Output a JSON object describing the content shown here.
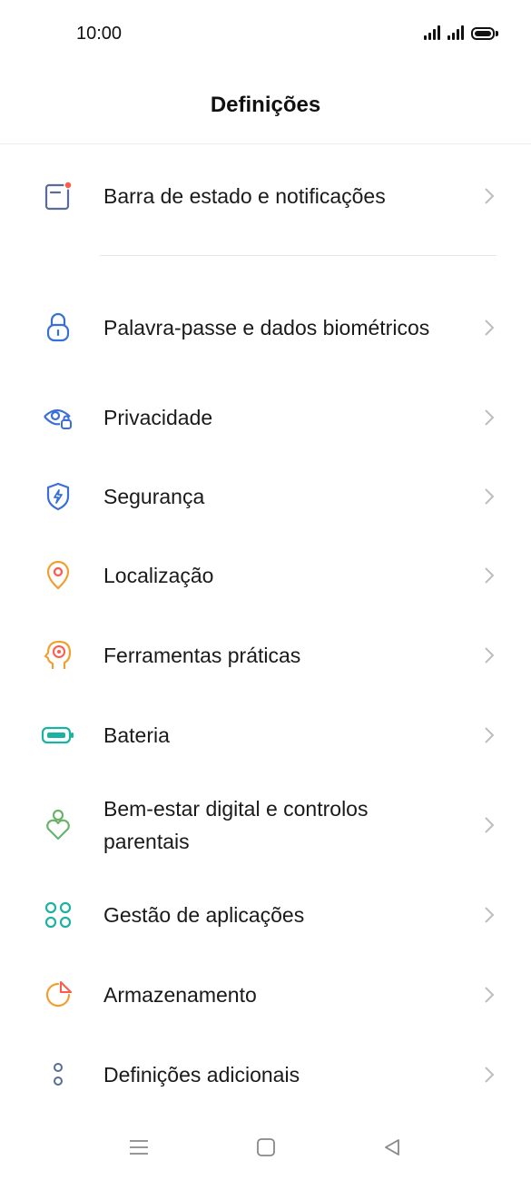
{
  "status_bar": {
    "time": "10:00"
  },
  "header": {
    "title": "Definições"
  },
  "items": [
    {
      "label": "Barra de estado e notificações",
      "icon": "status-bar-icon",
      "color": "#5a6a9a"
    },
    {
      "label": "Palavra-passe e dados biométricos",
      "icon": "lock-icon",
      "color": "#3a6fd8"
    },
    {
      "label": "Privacidade",
      "icon": "privacy-eye-lock-icon",
      "color": "#3a6fd8"
    },
    {
      "label": "Segurança",
      "icon": "shield-bolt-icon",
      "color": "#3a6fd8"
    },
    {
      "label": "Localização",
      "icon": "location-pin-icon",
      "color": "#f0a030"
    },
    {
      "label": "Ferramentas práticas",
      "icon": "head-target-icon",
      "color": "#f0a030"
    },
    {
      "label": "Bateria",
      "icon": "battery-icon",
      "color": "#1bb3a0"
    },
    {
      "label": "Bem-estar digital e controlos parentais",
      "icon": "wellbeing-heart-icon",
      "color": "#6bb36b"
    },
    {
      "label": "Gestão de aplicações",
      "icon": "apps-grid-icon",
      "color": "#1bb3a0"
    },
    {
      "label": "Armazenamento",
      "icon": "storage-pie-icon",
      "color": "#f0a030"
    },
    {
      "label": "Definições adicionais",
      "icon": "more-dots-icon",
      "color": "#5a6a9a"
    }
  ],
  "nav_bar": {
    "buttons": [
      "menu-button",
      "home-button",
      "back-button"
    ]
  }
}
